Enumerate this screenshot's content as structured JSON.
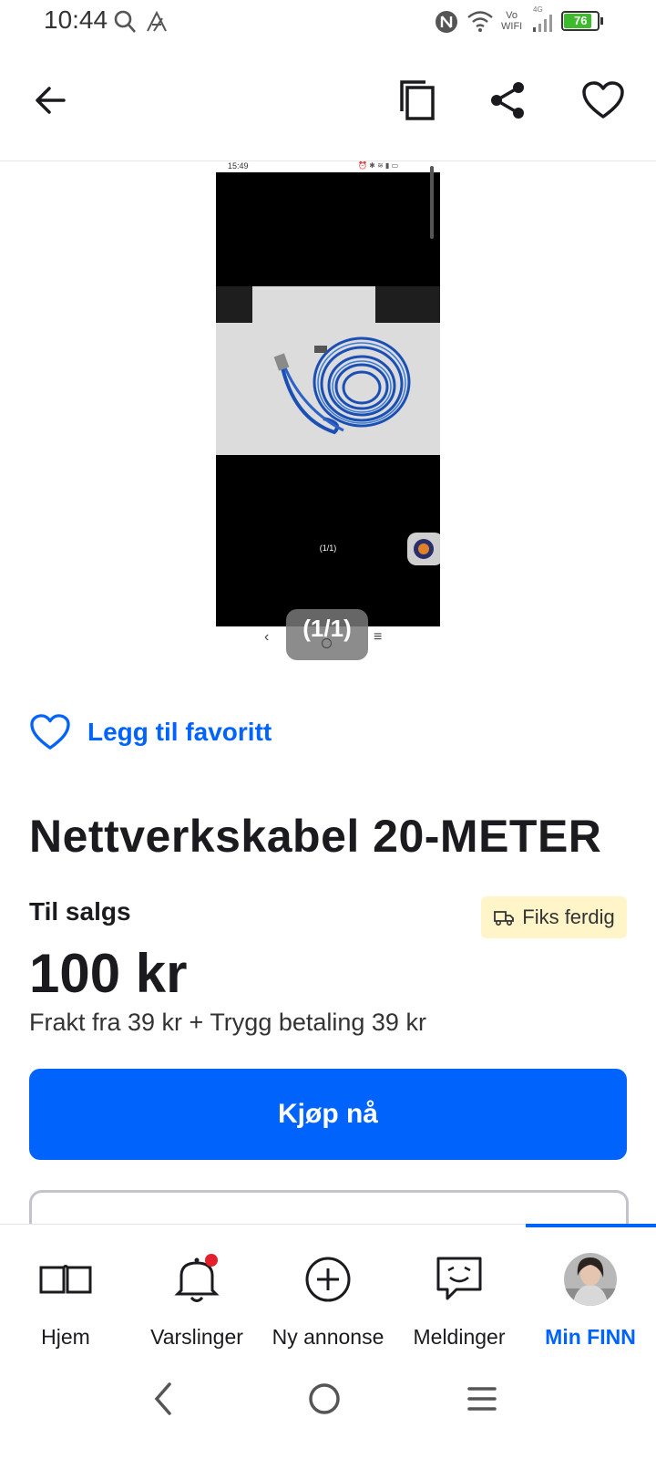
{
  "status_bar": {
    "time": "10:44",
    "network_top": "Vo",
    "network_bottom": "WIFI",
    "cell_type": "4G",
    "battery": "76"
  },
  "app_bar": {
    "back_icon": "arrow-left-icon",
    "copy_icon": "copy-icon",
    "share_icon": "share-icon",
    "favorite_icon": "heart-outline-icon"
  },
  "gallery": {
    "inner_status_time": "15:49",
    "inner_counter": "(1/1)",
    "counter": "(1/1)"
  },
  "favorite": {
    "label": "Legg til favoritt"
  },
  "listing": {
    "title": "Nettverkskabel 20-METER",
    "sale_label": "Til salgs",
    "shipping_badge": "Fiks ferdig",
    "price": "100 kr",
    "shipping_info": "Frakt fra 39 kr + Trygg betaling 39 kr",
    "buy_label": "Kjøp nå"
  },
  "bottom_nav": {
    "items": [
      {
        "label": "Hjem",
        "icon": "book-icon"
      },
      {
        "label": "Varslinger",
        "icon": "bell-icon"
      },
      {
        "label": "Ny annonse",
        "icon": "plus-circle-icon"
      },
      {
        "label": "Meldinger",
        "icon": "chat-icon"
      },
      {
        "label": "Min FINN",
        "icon": "avatar"
      }
    ],
    "active_index": 4
  },
  "colors": {
    "accent": "#0063fb",
    "badge_bg": "#fff5c8",
    "notification_dot": "#e3202b"
  }
}
